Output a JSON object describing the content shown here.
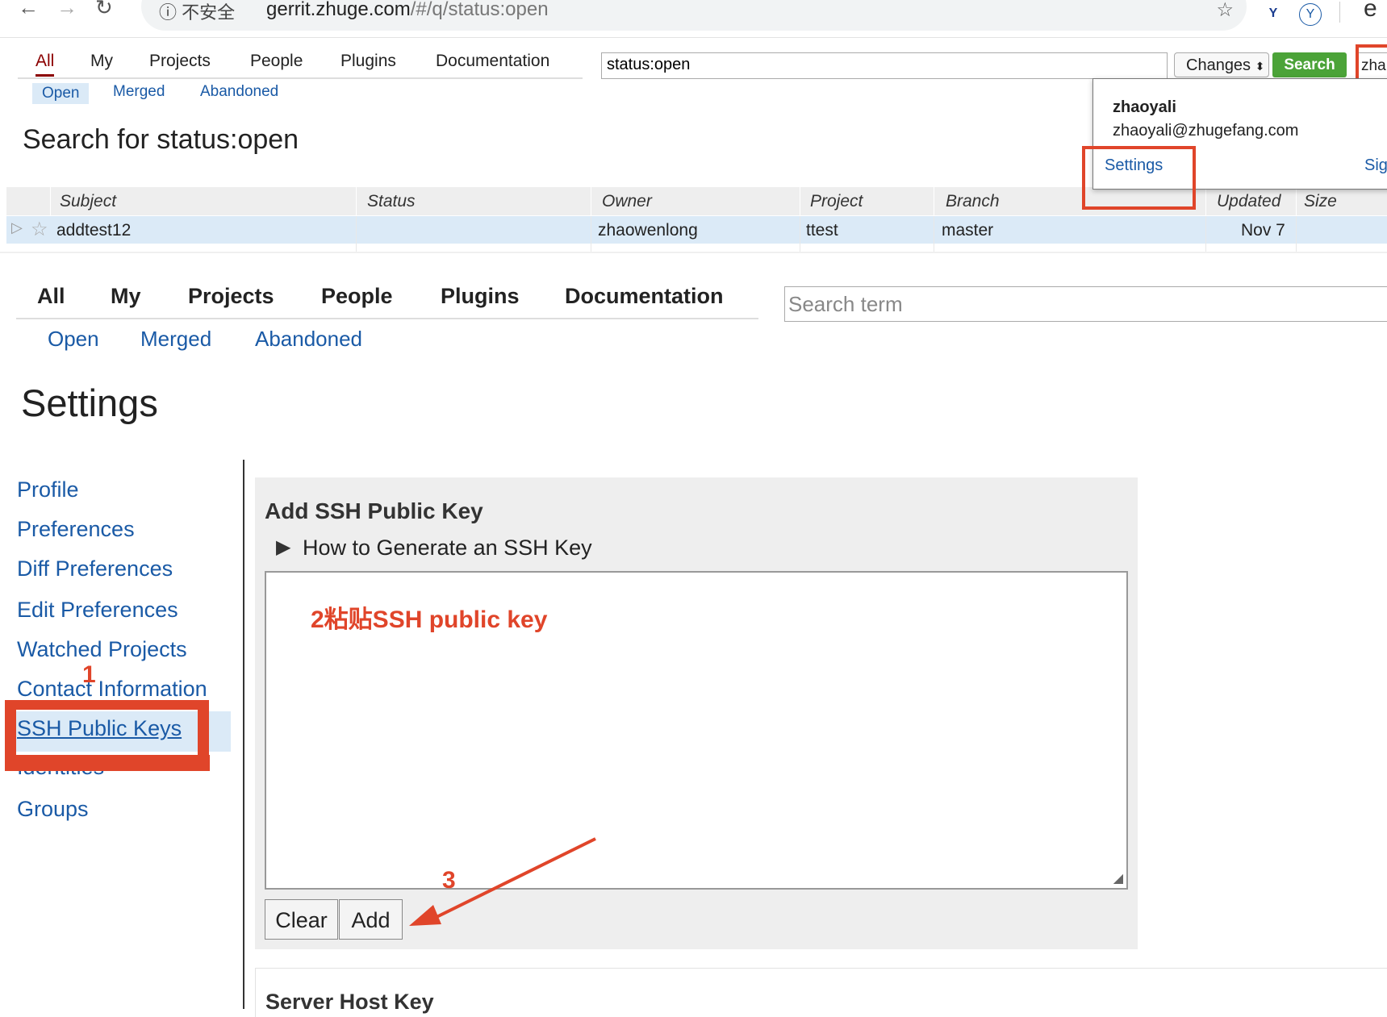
{
  "browser": {
    "security_text": "ⓘ 不安全",
    "url_host": "gerrit.zhuge.com",
    "url_path": "/#/q/status:open"
  },
  "search_page": {
    "nav_tabs": [
      "All",
      "My",
      "Projects",
      "People",
      "Plugins",
      "Documentation"
    ],
    "active_tab": "All",
    "sub_links": [
      "Open",
      "Merged",
      "Abandoned"
    ],
    "selected_sub": "Open",
    "search_value": "status:open",
    "search_type": "Changes",
    "search_button": "Search",
    "user_chip": "zha",
    "title": "Search for status:open",
    "user_menu": {
      "name": "zhaoyali",
      "email": "zhaoyali@zhugefang.com",
      "settings": "Settings",
      "sign_out": "Sig"
    },
    "table": {
      "headers": [
        "Subject",
        "Status",
        "Owner",
        "Project",
        "Branch",
        "Updated",
        "Size"
      ],
      "rows": [
        {
          "subject": "addtest12",
          "status": "",
          "owner": "zhaowenlong",
          "project": "ttest",
          "branch": "master",
          "updated": "Nov 7",
          "size": ""
        }
      ]
    }
  },
  "settings_page": {
    "nav_tabs": [
      "All",
      "My",
      "Projects",
      "People",
      "Plugins",
      "Documentation"
    ],
    "search_placeholder": "Search term",
    "sub_links": [
      "Open",
      "Merged",
      "Abandoned"
    ],
    "title": "Settings",
    "sidebar": [
      "Profile",
      "Preferences",
      "Diff Preferences",
      "Edit Preferences",
      "Watched Projects",
      "Contact Information",
      "SSH Public Keys",
      "Identities",
      "Groups"
    ],
    "selected_sidebar": "SSH Public Keys",
    "add_key_heading": "Add SSH Public Key",
    "how_to": "How to Generate an SSH Key",
    "clear_button": "Clear",
    "add_button": "Add",
    "server_host_key_heading": "Server Host Key"
  },
  "annotations": {
    "step1": "1",
    "step2": "2粘贴SSH public key",
    "step3": "3",
    "color": "#e0452a"
  },
  "colors": {
    "link": "#1a5aa6",
    "active_tab": "#8b0000",
    "search_button": "#4ba338",
    "selection": "#dbeaf7",
    "panel": "#eeeeee"
  }
}
